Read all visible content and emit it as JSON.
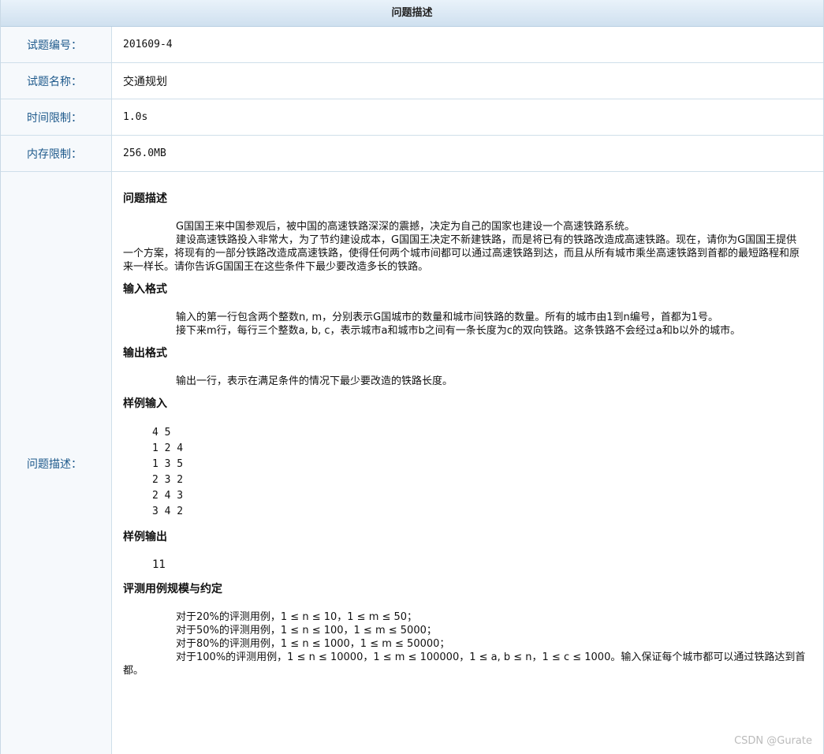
{
  "header": {
    "title": "问题描述"
  },
  "info": {
    "id_label": "试题编号：",
    "id_value": "201609-4",
    "name_label": "试题名称：",
    "name_value": "交通规划",
    "time_label": "时间限制：",
    "time_value": "1.0s",
    "mem_label": "内存限制：",
    "mem_value": "256.0MB",
    "desc_label": "问题描述："
  },
  "problem": {
    "sec1_title": "问题描述",
    "sec1_p1": "G国国王来中国参观后，被中国的高速铁路深深的震撼，决定为自己的国家也建设一个高速铁路系统。",
    "sec1_p2": "建设高速铁路投入非常大，为了节约建设成本，G国国王决定不新建铁路，而是将已有的铁路改造成高速铁路。现在，请你为G国国王提供一个方案，将现有的一部分铁路改造成高速铁路，使得任何两个城市间都可以通过高速铁路到达，而且从所有城市乘坐高速铁路到首都的最短路程和原来一样长。请你告诉G国国王在这些条件下最少要改造多长的铁路。",
    "sec2_title": "输入格式",
    "sec2_p1": "输入的第一行包含两个整数n, m，分别表示G国城市的数量和城市间铁路的数量。所有的城市由1到n编号，首都为1号。",
    "sec2_p2": "接下来m行，每行三个整数a, b, c，表示城市a和城市b之间有一条长度为c的双向铁路。这条铁路不会经过a和b以外的城市。",
    "sec3_title": "输出格式",
    "sec3_p1": "输出一行，表示在满足条件的情况下最少要改造的铁路长度。",
    "sec4_title": "样例输入",
    "sample_input": "4 5\n1 2 4\n1 3 5\n2 3 2\n2 4 3\n3 4 2",
    "sec5_title": "样例输出",
    "sample_output": "11",
    "sec6_title": "评测用例规模与约定",
    "scale_1": "对于20%的评测用例，1 ≤ n ≤ 10，1 ≤ m ≤ 50；",
    "scale_2": "对于50%的评测用例，1 ≤ n ≤ 100，1 ≤ m ≤ 5000；",
    "scale_3": "对于80%的评测用例，1 ≤ n ≤ 1000，1 ≤ m ≤ 50000；",
    "scale_4": "对于100%的评测用例，1 ≤ n ≤ 10000，1 ≤ m ≤ 100000，1 ≤ a, b ≤ n，1 ≤ c ≤ 1000。输入保证每个城市都可以通过铁路达到首都。",
    "watermark": "CSDN @Gurate"
  }
}
